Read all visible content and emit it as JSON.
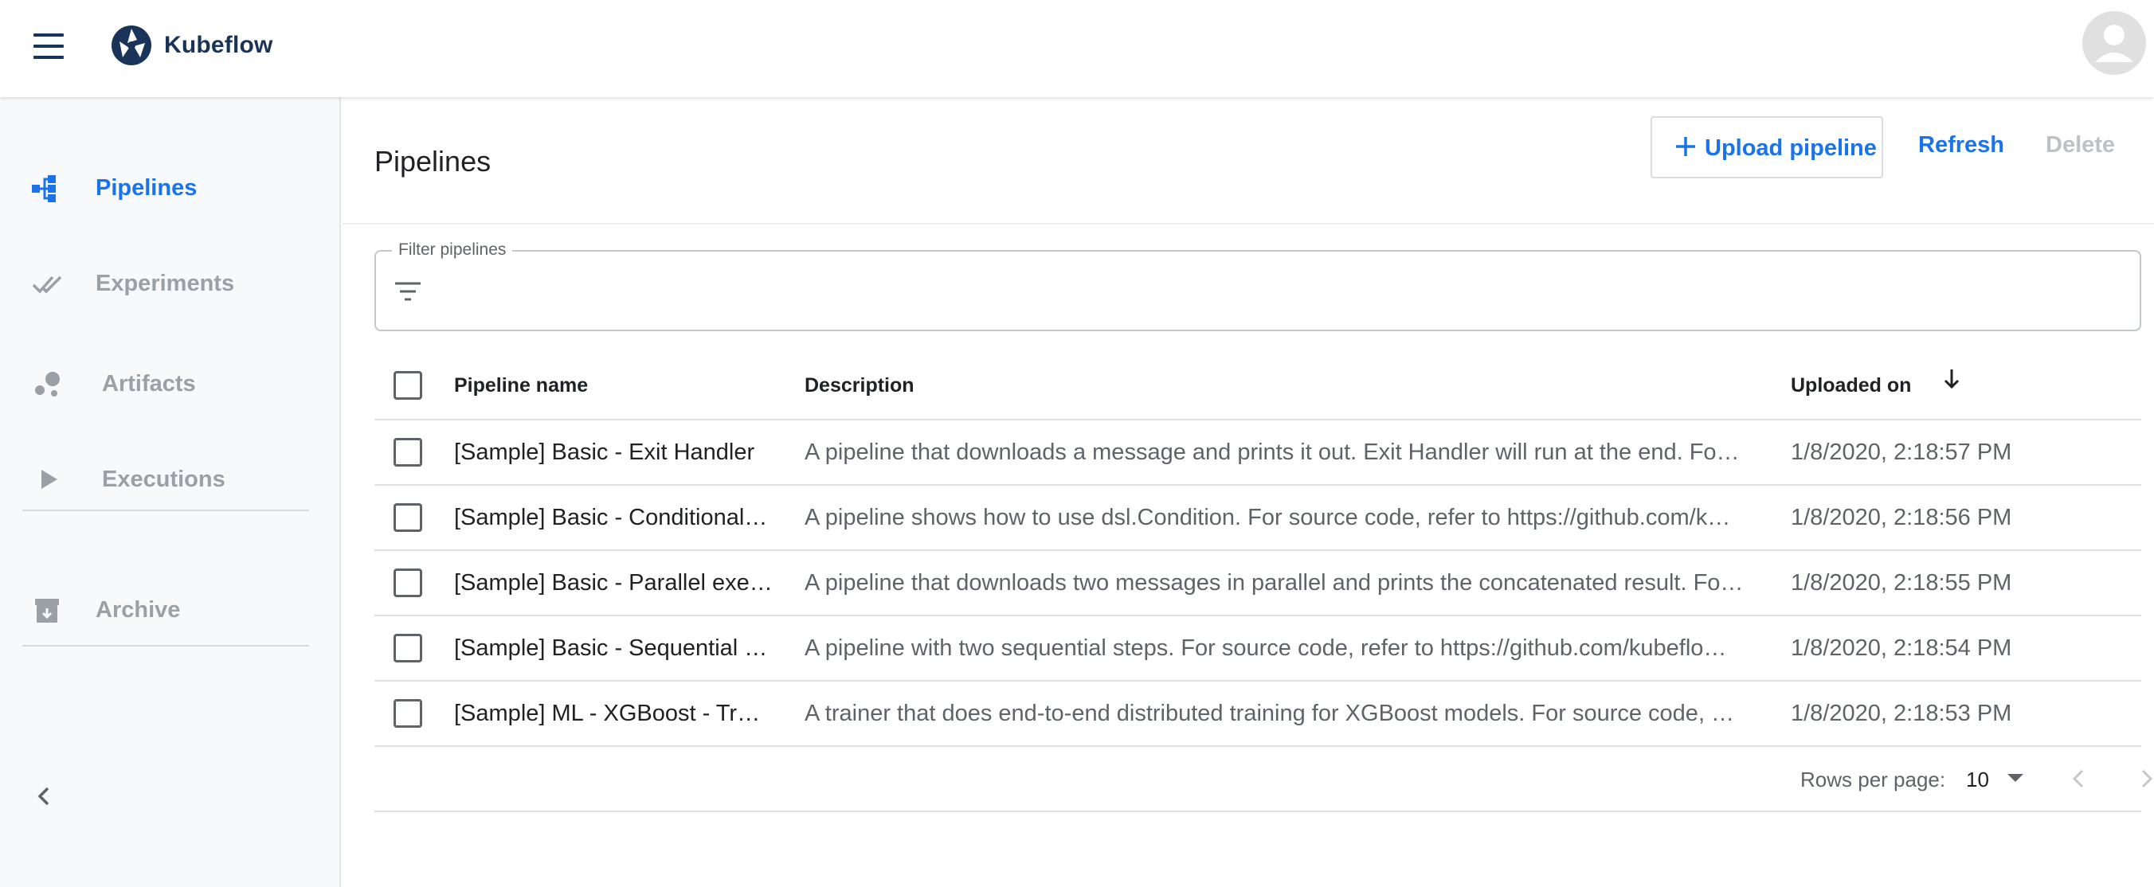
{
  "app": {
    "brand_name": "Kubeflow"
  },
  "colors": {
    "accent": "#1a73e8",
    "brand": "#1a3459",
    "muted": "#9aa0a6",
    "sidebar_bg": "#f8f9fa"
  },
  "sidebar": {
    "items": [
      {
        "label": "Pipelines",
        "icon": "pipelines-icon",
        "active": true
      },
      {
        "label": "Experiments",
        "icon": "double-check-icon",
        "active": false
      },
      {
        "label": "Artifacts",
        "icon": "bubbles-icon",
        "active": false
      },
      {
        "label": "Executions",
        "icon": "play-icon",
        "active": false
      },
      {
        "label": "Archive",
        "icon": "archive-icon",
        "active": false
      }
    ],
    "collapse_icon": "chevron-left-icon"
  },
  "header": {
    "title": "Pipelines",
    "upload_label": "Upload pipeline",
    "refresh_label": "Refresh",
    "delete_label": "Delete"
  },
  "filter": {
    "legend": "Filter pipelines",
    "value": "",
    "icon": "filter-list-icon"
  },
  "table": {
    "columns": [
      "Pipeline name",
      "Description",
      "Uploaded on"
    ],
    "sort_icon": "arrow-down-icon",
    "rows": [
      {
        "name": "[Sample] Basic - Exit Handler",
        "description": "A pipeline that downloads a message and prints it out. Exit Handler will run at the end. Fo…",
        "uploaded": "1/8/2020, 2:18:57 PM"
      },
      {
        "name": "[Sample] Basic - Conditional…",
        "description": "A pipeline shows how to use dsl.Condition. For source code, refer to https://github.com/k…",
        "uploaded": "1/8/2020, 2:18:56 PM"
      },
      {
        "name": "[Sample] Basic - Parallel exe…",
        "description": "A pipeline that downloads two messages in parallel and prints the concatenated result. Fo…",
        "uploaded": "1/8/2020, 2:18:55 PM"
      },
      {
        "name": "[Sample] Basic - Sequential …",
        "description": "A pipeline with two sequential steps. For source code, refer to https://github.com/kubeflo…",
        "uploaded": "1/8/2020, 2:18:54 PM"
      },
      {
        "name": "[Sample] ML - XGBoost - Tr…",
        "description": "A trainer that does end-to-end distributed training for XGBoost models. For source code, …",
        "uploaded": "1/8/2020, 2:18:53 PM"
      }
    ]
  },
  "pagination": {
    "rows_per_page_label": "Rows per page:",
    "rows_per_page": "10"
  }
}
